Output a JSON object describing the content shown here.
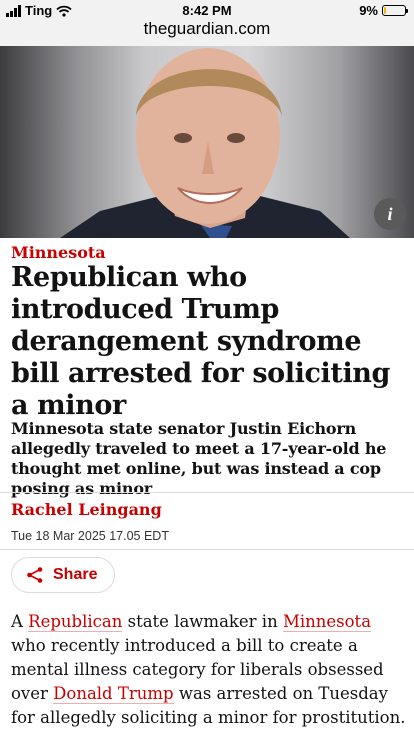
{
  "status_bar": {
    "carrier": "Ting",
    "time": "8:42 PM",
    "battery": "9%",
    "battery_level": 0.09
  },
  "browser": {
    "url": "theguardian.com"
  },
  "hero": {
    "info_label": "i"
  },
  "article": {
    "kicker": "Minnesota",
    "headline": "Republican who introduced Trump derangement syndrome bill arrested for soliciting a minor",
    "standfirst": "Minnesota state senator Justin Eichorn allegedly traveled to meet a 17-year-old he thought met online, but was instead a cop posing as minor",
    "byline": "Rachel Leingang",
    "dateline": "Tue 18 Mar 2025 17.05 EDT",
    "share_label": "Share",
    "body": {
      "t1": "A ",
      "link1": "Republican",
      "t2": " state lawmaker in ",
      "link2": "Minnesota",
      "t3": " who recently introduced a bill to create a mental illness category for liberals obsessed over ",
      "link3": "Donald Trump",
      "t4": " was arrested on Tuesday for allegedly soliciting a minor for prostitution."
    }
  },
  "colors": {
    "accent": "#c70000",
    "status_bg": "#f2f2f2",
    "battery": "#f2b90d"
  }
}
